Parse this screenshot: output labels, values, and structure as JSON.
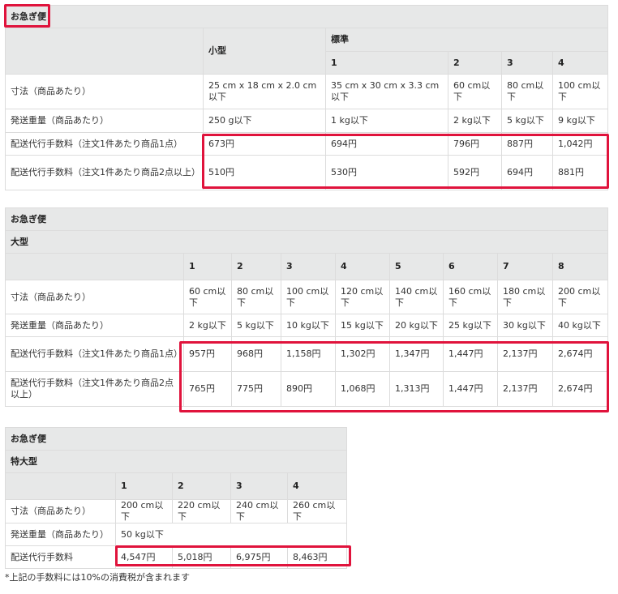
{
  "t1": {
    "title": "お急ぎ便",
    "col_small": "小型",
    "col_std": "標準",
    "std_sizes": [
      "1",
      "2",
      "3",
      "4"
    ],
    "rows": [
      {
        "label": "寸法（商品あたり）",
        "small": "25 cm x 18 cm x 2.0 cm以下",
        "std": [
          "35 cm x 30 cm x 3.3 cm以下",
          "60 cm以下",
          "80 cm以下",
          "100 cm以下"
        ]
      },
      {
        "label": "発送重量（商品あたり）",
        "small": "250 g以下",
        "std": [
          "1 kg以下",
          "2 kg以下",
          "5 kg以下",
          "9 kg以下"
        ]
      },
      {
        "label": "配送代行手数料（注文1件あたり商品1点）",
        "small": "673円",
        "std": [
          "694円",
          "796円",
          "887円",
          "1,042円"
        ]
      },
      {
        "label": "配送代行手数料（注文1件あたり商品2点以上）",
        "small": "510円",
        "std": [
          "530円",
          "592円",
          "694円",
          "881円"
        ]
      }
    ]
  },
  "t2": {
    "title": "お急ぎ便",
    "subtitle": "大型",
    "sizes": [
      "1",
      "2",
      "3",
      "4",
      "5",
      "6",
      "7",
      "8"
    ],
    "rows": [
      {
        "label": "寸法（商品あたり）",
        "values": [
          "60 cm以下",
          "80 cm以下",
          "100 cm以下",
          "120 cm以下",
          "140 cm以下",
          "160 cm以下",
          "180 cm以下",
          "200 cm以下"
        ]
      },
      {
        "label": "発送重量（商品あたり）",
        "values": [
          "2 kg以下",
          "5 kg以下",
          "10 kg以下",
          "15 kg以下",
          "20 kg以下",
          "25 kg以下",
          "30 kg以下",
          "40 kg以下"
        ]
      },
      {
        "label": "配送代行手数料（注文1件あたり商品1点）",
        "values": [
          "957円",
          "968円",
          "1,158円",
          "1,302円",
          "1,347円",
          "1,447円",
          "2,137円",
          "2,674円"
        ]
      },
      {
        "label": "配送代行手数料（注文1件あたり商品2点以上）",
        "values": [
          "765円",
          "775円",
          "890円",
          "1,068円",
          "1,313円",
          "1,447円",
          "2,137円",
          "2,674円"
        ]
      }
    ]
  },
  "t3": {
    "title": "お急ぎ便",
    "subtitle": "特大型",
    "sizes": [
      "1",
      "2",
      "3",
      "4"
    ],
    "dim_label": "寸法（商品あたり）",
    "dims": [
      "200 cm以下",
      "220 cm以下",
      "240 cm以下",
      "260 cm以下"
    ],
    "weight_label": "発送重量（商品あたり）",
    "weight": "50 kg以下",
    "fee_label": "配送代行手数料",
    "fees": [
      "4,547円",
      "5,018円",
      "6,975円",
      "8,463円"
    ]
  },
  "footnote": "*上記の手数料には10%の消費税が含まれます",
  "colors": {
    "highlight": "#e0133c",
    "header_bg": "#e7e8e8",
    "border": "#dcdcdc"
  }
}
